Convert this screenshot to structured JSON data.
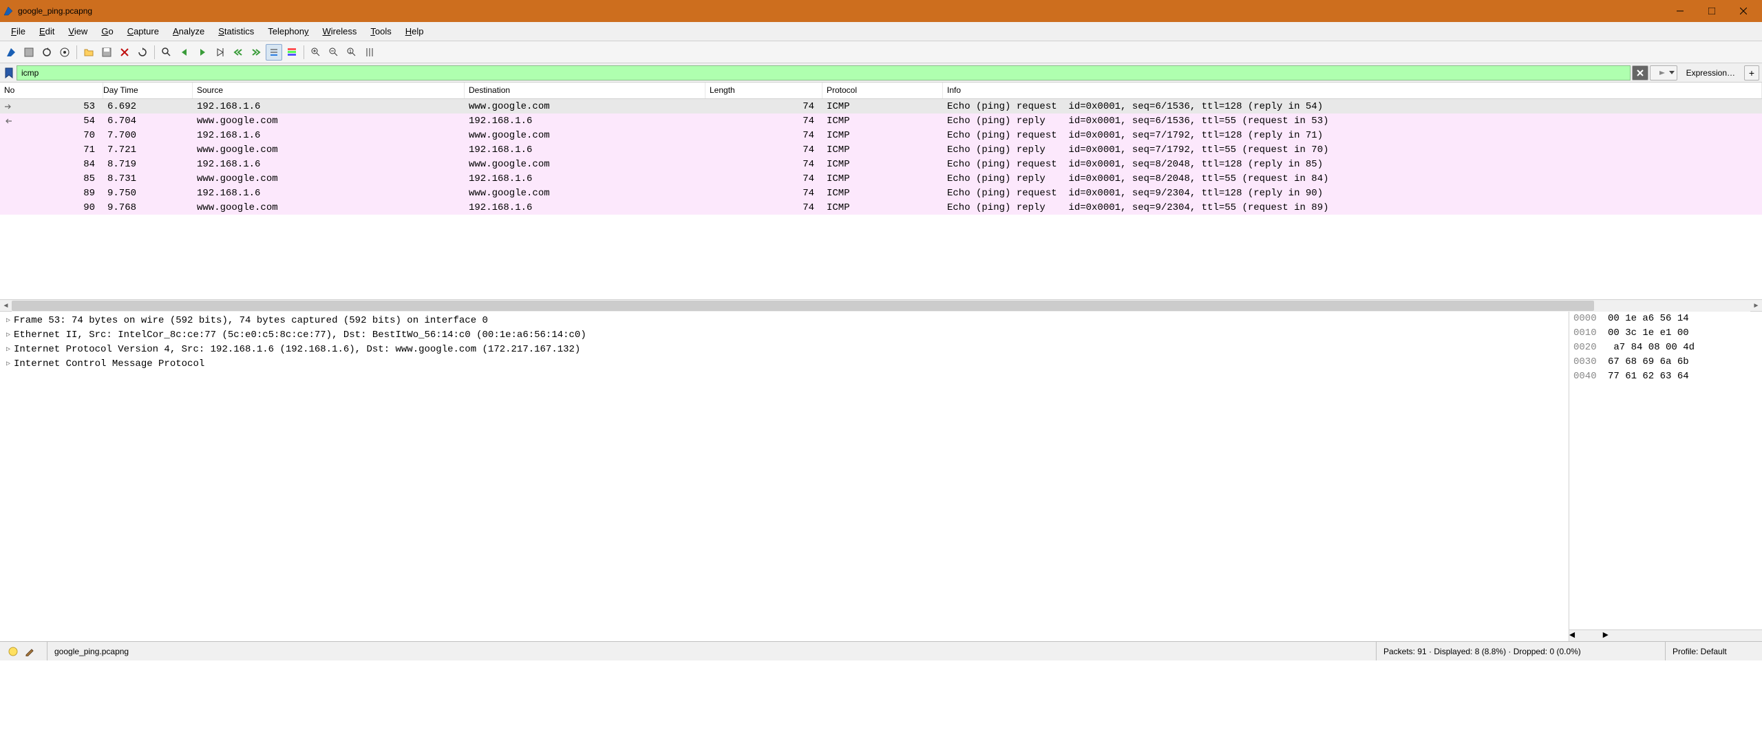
{
  "window": {
    "title": "google_ping.pcapng"
  },
  "menu": {
    "file": "File",
    "edit": "Edit",
    "view": "View",
    "go": "Go",
    "capture": "Capture",
    "analyze": "Analyze",
    "statistics": "Statistics",
    "telephony": "Telephony",
    "wireless": "Wireless",
    "tools": "Tools",
    "help": "Help"
  },
  "filter": {
    "value": "icmp",
    "expression_label": "Expression…"
  },
  "columns": {
    "no": "No",
    "time": "Day Time",
    "source": "Source",
    "destination": "Destination",
    "length": "Length",
    "protocol": "Protocol",
    "info": "Info"
  },
  "packets": [
    {
      "no": "53",
      "time": "6.692",
      "src": "192.168.1.6",
      "dst": "www.google.com",
      "len": "74",
      "proto": "ICMP",
      "info": "Echo (ping) request  id=0x0001, seq=6/1536, ttl=128 (reply in 54)",
      "selected": true,
      "marker": "right"
    },
    {
      "no": "54",
      "time": "6.704",
      "src": "www.google.com",
      "dst": "192.168.1.6",
      "len": "74",
      "proto": "ICMP",
      "info": "Echo (ping) reply    id=0x0001, seq=6/1536, ttl=55 (request in 53)",
      "marker": "left"
    },
    {
      "no": "70",
      "time": "7.700",
      "src": "192.168.1.6",
      "dst": "www.google.com",
      "len": "74",
      "proto": "ICMP",
      "info": "Echo (ping) request  id=0x0001, seq=7/1792, ttl=128 (reply in 71)"
    },
    {
      "no": "71",
      "time": "7.721",
      "src": "www.google.com",
      "dst": "192.168.1.6",
      "len": "74",
      "proto": "ICMP",
      "info": "Echo (ping) reply    id=0x0001, seq=7/1792, ttl=55 (request in 70)"
    },
    {
      "no": "84",
      "time": "8.719",
      "src": "192.168.1.6",
      "dst": "www.google.com",
      "len": "74",
      "proto": "ICMP",
      "info": "Echo (ping) request  id=0x0001, seq=8/2048, ttl=128 (reply in 85)"
    },
    {
      "no": "85",
      "time": "8.731",
      "src": "www.google.com",
      "dst": "192.168.1.6",
      "len": "74",
      "proto": "ICMP",
      "info": "Echo (ping) reply    id=0x0001, seq=8/2048, ttl=55 (request in 84)"
    },
    {
      "no": "89",
      "time": "9.750",
      "src": "192.168.1.6",
      "dst": "www.google.com",
      "len": "74",
      "proto": "ICMP",
      "info": "Echo (ping) request  id=0x0001, seq=9/2304, ttl=128 (reply in 90)"
    },
    {
      "no": "90",
      "time": "9.768",
      "src": "www.google.com",
      "dst": "192.168.1.6",
      "len": "74",
      "proto": "ICMP",
      "info": "Echo (ping) reply    id=0x0001, seq=9/2304, ttl=55 (request in 89)"
    }
  ],
  "details": [
    "Frame 53: 74 bytes on wire (592 bits), 74 bytes captured (592 bits) on interface 0",
    "Ethernet II, Src: IntelCor_8c:ce:77 (5c:e0:c5:8c:ce:77), Dst: BestItWo_56:14:c0 (00:1e:a6:56:14:c0)",
    "Internet Protocol Version 4, Src: 192.168.1.6 (192.168.1.6), Dst: www.google.com (172.217.167.132)",
    "Internet Control Message Protocol"
  ],
  "hex": [
    {
      "offset": "0000",
      "bytes": "00 1e a6 56 14"
    },
    {
      "offset": "0010",
      "bytes": "00 3c 1e e1 00"
    },
    {
      "offset": "0020",
      "bytes": " a7 84 08 00 4d"
    },
    {
      "offset": "0030",
      "bytes": "67 68 69 6a 6b"
    },
    {
      "offset": "0040",
      "bytes": "77 61 62 63 64"
    }
  ],
  "status": {
    "file": "google_ping.pcapng",
    "packets": "Packets: 91 · Displayed: 8 (8.8%) · Dropped: 0 (0.0%)",
    "profile": "Profile: Default"
  }
}
